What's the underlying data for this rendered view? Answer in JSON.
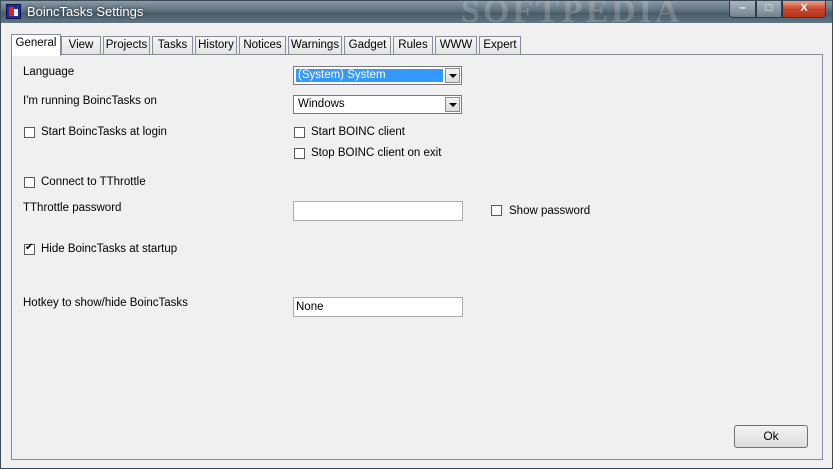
{
  "window": {
    "title": "BoincTasks Settings",
    "watermark": "SOFTPEDIA",
    "minimize_glyph": "–",
    "maximize_glyph": "□",
    "close_glyph": "X"
  },
  "tabs": [
    {
      "label": "General",
      "active": true
    },
    {
      "label": "View"
    },
    {
      "label": "Projects"
    },
    {
      "label": "Tasks"
    },
    {
      "label": "History"
    },
    {
      "label": "Notices"
    },
    {
      "label": "Warnings"
    },
    {
      "label": "Gadget"
    },
    {
      "label": "Rules"
    },
    {
      "label": "WWW"
    },
    {
      "label": "Expert"
    }
  ],
  "general": {
    "language_label": "Language",
    "language_value": "(System) System",
    "running_on_label": "I'm running BoincTasks on",
    "running_on_value": "Windows",
    "start_at_login_label": "Start BoincTasks at login",
    "start_at_login_checked": false,
    "start_boinc_client_label": "Start BOINC client",
    "start_boinc_client_checked": false,
    "stop_boinc_client_label": "Stop BOINC client on exit",
    "stop_boinc_client_checked": false,
    "connect_tthrottle_label": "Connect to TThrottle",
    "connect_tthrottle_checked": false,
    "tthrottle_password_label": "TThrottle password",
    "tthrottle_password_value": "",
    "show_password_label": "Show password",
    "show_password_checked": false,
    "hide_at_startup_label": "Hide BoincTasks at startup",
    "hide_at_startup_checked": true,
    "hotkey_label": "Hotkey to show/hide BoincTasks",
    "hotkey_value": "None"
  },
  "buttons": {
    "ok_label": "Ok"
  }
}
